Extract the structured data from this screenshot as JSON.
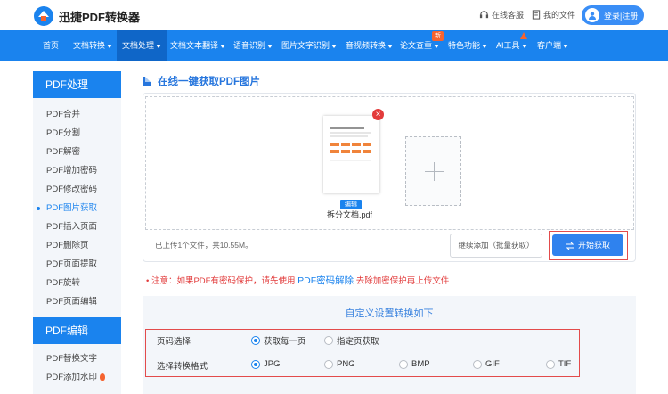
{
  "header": {
    "logo_text": "迅捷PDF转换器",
    "support_label": "在线客服",
    "files_label": "我的文件",
    "login_label": "登录|注册"
  },
  "nav": {
    "items": [
      {
        "label": "首页"
      },
      {
        "label": "文档转换"
      },
      {
        "label": "文档处理"
      },
      {
        "label": "文档文本翻译"
      },
      {
        "label": "语音识别"
      },
      {
        "label": "图片文字识别"
      },
      {
        "label": "音视频转换"
      },
      {
        "label": "论文查重"
      },
      {
        "label": "特色功能"
      },
      {
        "label": "AI工具"
      },
      {
        "label": "客户端"
      }
    ],
    "new_badge": "新"
  },
  "sidebar": {
    "section1_title": "PDF处理",
    "section1_items": [
      {
        "label": "PDF合并"
      },
      {
        "label": "PDF分割"
      },
      {
        "label": "PDF解密"
      },
      {
        "label": "PDF增加密码"
      },
      {
        "label": "PDF修改密码"
      },
      {
        "label": "PDF图片获取"
      },
      {
        "label": "PDF插入页面"
      },
      {
        "label": "PDF删除页"
      },
      {
        "label": "PDF页面提取"
      },
      {
        "label": "PDF旋转"
      },
      {
        "label": "PDF页面编辑"
      }
    ],
    "section2_title": "PDF编辑",
    "section2_items": [
      {
        "label": "PDF替换文字"
      },
      {
        "label": "PDF添加水印"
      }
    ]
  },
  "main": {
    "title": "在线一键获取PDF图片",
    "file_name": "拆分文档.pdf",
    "edit_label": "编辑",
    "close_symbol": "×",
    "upload_status": "已上传1个文件，共10.55M。",
    "continue_label": "继续添加（批量获取）",
    "start_label": "开始获取",
    "notice_prefix": "•  注意：如果PDF有密码保护，请先使用",
    "notice_link": "PDF密码解除",
    "notice_suffix": "去除加密保护再上传文件"
  },
  "settings": {
    "title": "自定义设置转换如下",
    "page_label": "页码选择",
    "page_options": [
      {
        "label": "获取每一页",
        "checked": true
      },
      {
        "label": "指定页获取",
        "checked": false
      }
    ],
    "format_label": "选择转换格式",
    "format_options": [
      {
        "label": "JPG",
        "checked": true
      },
      {
        "label": "PNG",
        "checked": false
      },
      {
        "label": "BMP",
        "checked": false
      },
      {
        "label": "GIF",
        "checked": false
      },
      {
        "label": "TIF",
        "checked": false
      }
    ]
  },
  "colors": {
    "brand_blue": "#1a83ee",
    "highlight_red": "#e34b4b"
  }
}
